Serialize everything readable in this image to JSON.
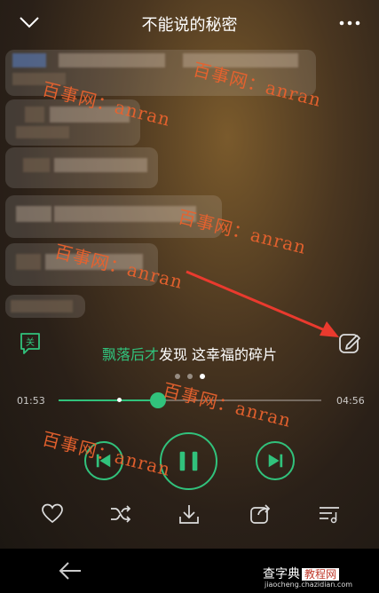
{
  "header": {
    "title": "不能说的秘密",
    "back_icon": "chevron-down-icon",
    "more_icon": "more-dots-icon"
  },
  "watermark": {
    "texts": [
      "百事网：anran",
      "百事网：anran",
      "百事网：anran",
      "百事网：anran",
      "百事网：anran",
      "百事网：anran"
    ],
    "color": "#e8622e"
  },
  "danmu": {
    "label": "关"
  },
  "lyric": {
    "sung": "飘落后才",
    "unsung": "发现 这幸福的碎片"
  },
  "progress": {
    "current": "01:53",
    "total": "04:56",
    "fraction": 0.38,
    "buffer_fraction": 0.23
  },
  "controls": {
    "prev_icon": "previous-icon",
    "play_icon": "pause-icon",
    "next_icon": "next-icon"
  },
  "bottom_actions": [
    "heart-icon",
    "shuffle-icon",
    "download-icon",
    "share-icon",
    "playlist-icon"
  ],
  "colors": {
    "accent": "#31c27c",
    "watermark": "#e8622e"
  },
  "site": {
    "name_a": "查字典",
    "name_b": "教程网",
    "url": "jiaocheng.chazidian.com"
  }
}
